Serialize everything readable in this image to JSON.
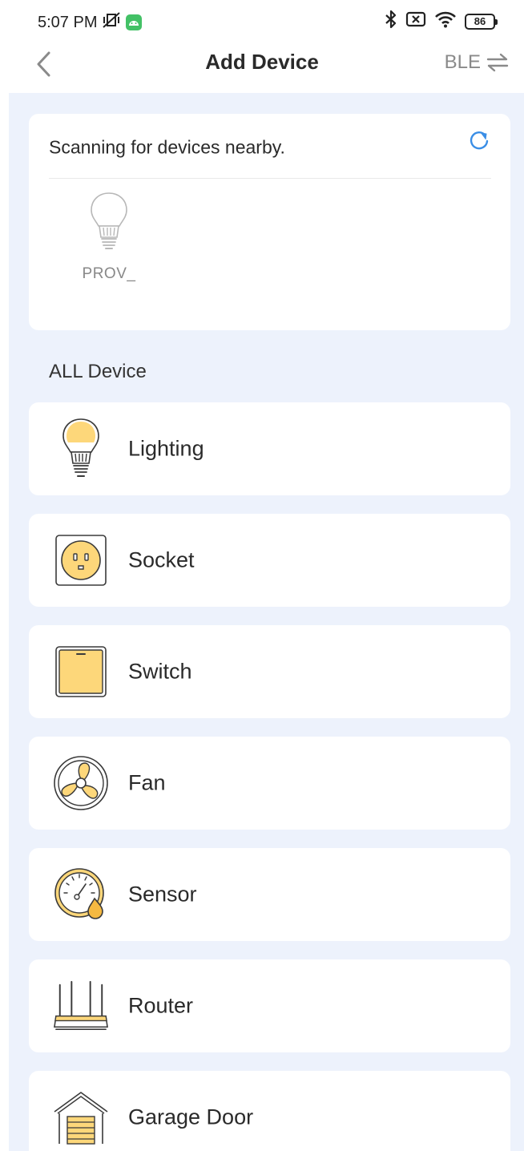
{
  "status_bar": {
    "time": "5:07 PM",
    "battery": "86"
  },
  "header": {
    "title": "Add Device",
    "ble_label": "BLE"
  },
  "scan": {
    "status_text": "Scanning for devices nearby.",
    "found_devices": [
      {
        "name": "PROV_",
        "icon": "bulb-icon"
      }
    ]
  },
  "all_devices": {
    "title": "ALL Device",
    "items": [
      {
        "label": "Lighting",
        "icon": "lighting-icon"
      },
      {
        "label": "Socket",
        "icon": "socket-icon"
      },
      {
        "label": "Switch",
        "icon": "switch-icon"
      },
      {
        "label": "Fan",
        "icon": "fan-icon"
      },
      {
        "label": "Sensor",
        "icon": "sensor-icon"
      },
      {
        "label": "Router",
        "icon": "router-icon"
      },
      {
        "label": "Garage Door",
        "icon": "garage-door-icon"
      }
    ]
  },
  "colors": {
    "accent": "#3a8ee6",
    "background": "#edf2fc",
    "icon_fill": "#fdd77a",
    "icon_stroke": "#3a3a3a"
  }
}
